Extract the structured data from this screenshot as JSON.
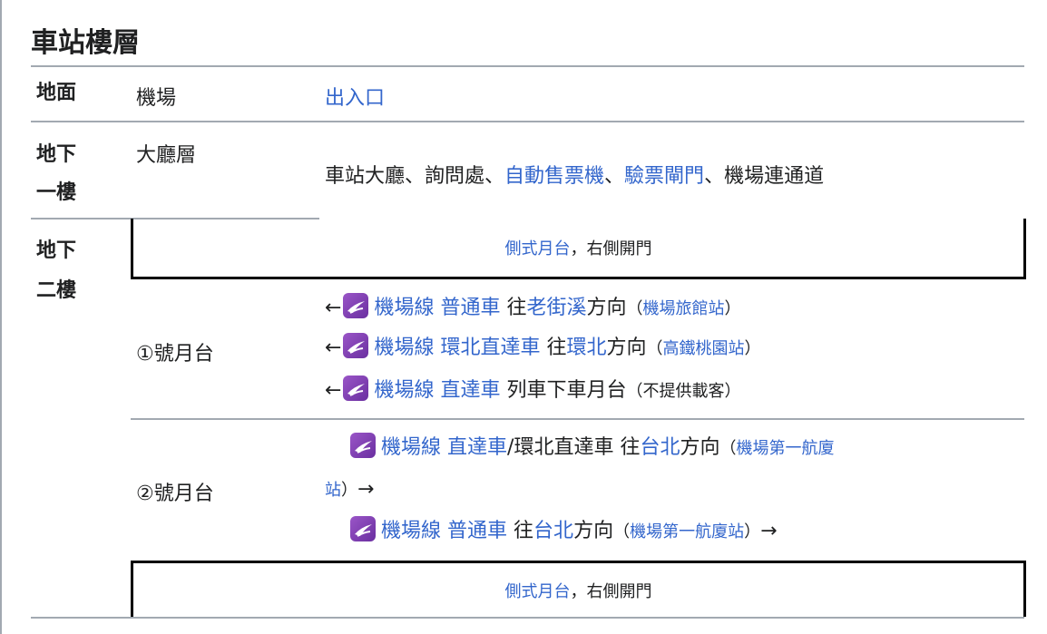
{
  "title": "車站樓層",
  "floors": {
    "ground": {
      "label": "地面",
      "location": "機場",
      "content": "出入口"
    },
    "b1": {
      "label_line1": "地下",
      "label_line2": "一樓",
      "location": "大廳層",
      "content": {
        "t1": "車站大廳、詢問處、",
        "l1": "自動售票機",
        "t2": "、",
        "l2": "驗票閘門",
        "t3": "、機場連通道"
      }
    },
    "b2": {
      "label_line1": "地下",
      "label_line2": "二樓"
    }
  },
  "side_platform": {
    "label": "側式月台",
    "suffix": "，右側開門"
  },
  "platform1": {
    "label": "①號月台",
    "rows": [
      {
        "arrow": "←",
        "line": "機場線",
        "service": "普通車",
        "pre": "往",
        "dest": "老街溪",
        "dir": "方向",
        "open": "（",
        "station": "機場旅館站",
        "close": "）"
      },
      {
        "arrow": "←",
        "line": "機場線",
        "service": "環北直達車",
        "pre": "往",
        "dest": "環北",
        "dir": "方向",
        "open": "（",
        "station": "高鐵桃園站",
        "close": "）"
      },
      {
        "arrow": "←",
        "line": "機場線",
        "service": "直達車",
        "rest": "列車下車月台",
        "open": "（",
        "note": "不提供載客",
        "close": "）"
      }
    ]
  },
  "platform2": {
    "label": "②號月台",
    "rows": [
      {
        "line": "機場線",
        "service": "直達車",
        "mid": "/環北直達車",
        "pre": "往",
        "dest": "台北",
        "dir": "方向",
        "open": "（",
        "station_part1": "機場第一航廈",
        "station_part2": "站",
        "close": "）",
        "arrow": "→"
      },
      {
        "line": "機場線",
        "service": "普通車",
        "pre": "往",
        "dest": "台北",
        "dir": "方向",
        "open": "（",
        "station": "機場第一航廈站",
        "close": "）",
        "arrow": "→"
      }
    ]
  },
  "colors": {
    "link": "#3366cc",
    "logo": "#7b3fb0",
    "rule": "#a2a9b1"
  }
}
